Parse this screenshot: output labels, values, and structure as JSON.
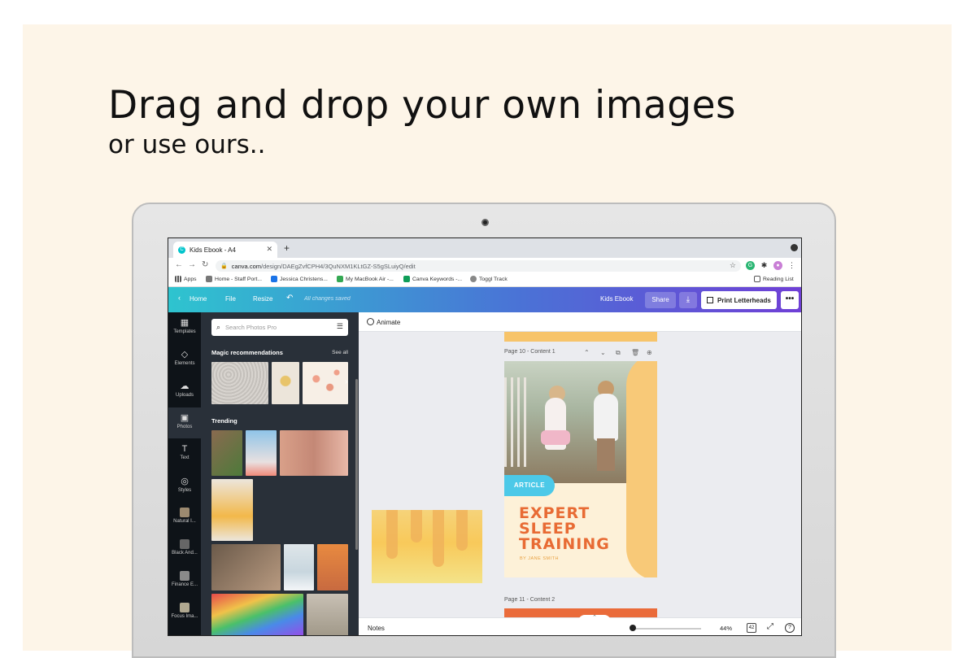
{
  "hero": {
    "headline": "Drag and drop your own images",
    "subline": "or use ours.."
  },
  "browser": {
    "tab_title": "Kids Ebook - A4",
    "url_host": "canva.com",
    "url_path": "/design/DAEgZvfCPH4/3QuNXM1KLtGZ-S5gSLuiyQ/edit",
    "bookmarks": [
      "Apps",
      "Home - Staff Port...",
      "Jessica Christens...",
      "My MacBook Air -...",
      "Canva Keywords -...",
      "Toggl Track"
    ],
    "reading_list": "Reading List"
  },
  "header": {
    "home": "Home",
    "file": "File",
    "resize": "Resize",
    "saved": "All changes saved",
    "doc_title": "Kids Ebook",
    "share": "Share",
    "print": "Print Letterheads",
    "more": "•••"
  },
  "rail": {
    "items": [
      "Templates",
      "Elements",
      "Uploads",
      "Photos",
      "Text",
      "Styles",
      "Natural I...",
      "Black And...",
      "Finance E...",
      "Focus Ima..."
    ]
  },
  "panel": {
    "search_placeholder": "Search Photos Pro",
    "magic": "Magic recommendations",
    "see_all": "See all",
    "trending": "Trending"
  },
  "canvas": {
    "animate": "Animate",
    "page10": "Page 10 - Content 1",
    "page11": "Page 11 - Content 2",
    "article": "ARTICLE",
    "title_lines": [
      "EXPERT",
      "SLEEP",
      "TRAINING"
    ],
    "byline": "BY JANE SMITH"
  },
  "footer": {
    "notes": "Notes",
    "zoom": "44%",
    "page_count": "42",
    "help": "?"
  },
  "colors": {
    "background": "#fdf5e8",
    "canva_gradient_start": "#2ec4cf",
    "canva_gradient_end": "#6f3fd6",
    "title_orange": "#e86b34",
    "accent_yellow": "#f8c978",
    "article_blue": "#4cc9e8"
  }
}
